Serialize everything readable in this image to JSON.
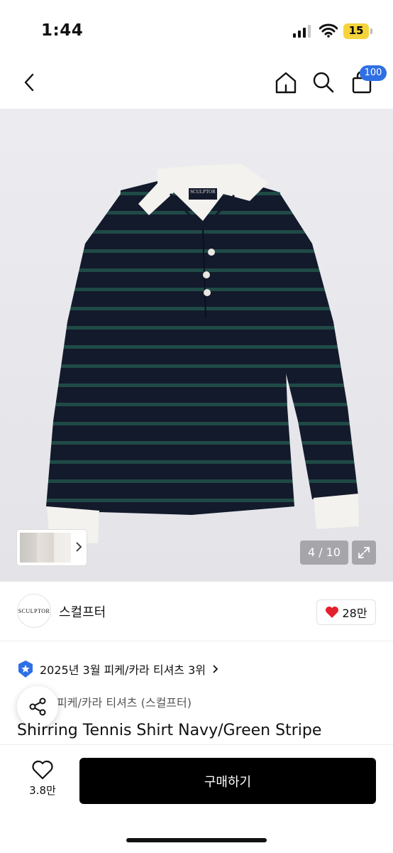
{
  "status": {
    "time": "1:44",
    "battery": "15"
  },
  "nav": {
    "cart_count": "100"
  },
  "gallery": {
    "counter": "4 / 10",
    "product_logo_text": "SCULPTOR",
    "image_colors": {
      "body": "#131a2b",
      "stripe": "#1f4a46",
      "collar": "#f4f2ee"
    }
  },
  "brand": {
    "logo_text": "SCULPTOR",
    "name": "스컬프터",
    "likes": "28만"
  },
  "ranking": {
    "text": "2025년 3월 피케/카라 티셔츠 3위"
  },
  "category": {
    "text": "피케/카라 티셔츠 (스컬프터)"
  },
  "product": {
    "title": "Shirring Tennis Shirt Navy/Green Stripe"
  },
  "footer": {
    "wish_count": "3.8만",
    "buy_label": "구매하기"
  },
  "colors": {
    "accent": "#2f6fe4",
    "heart": "#e5202e",
    "buy_bg": "#000000"
  }
}
